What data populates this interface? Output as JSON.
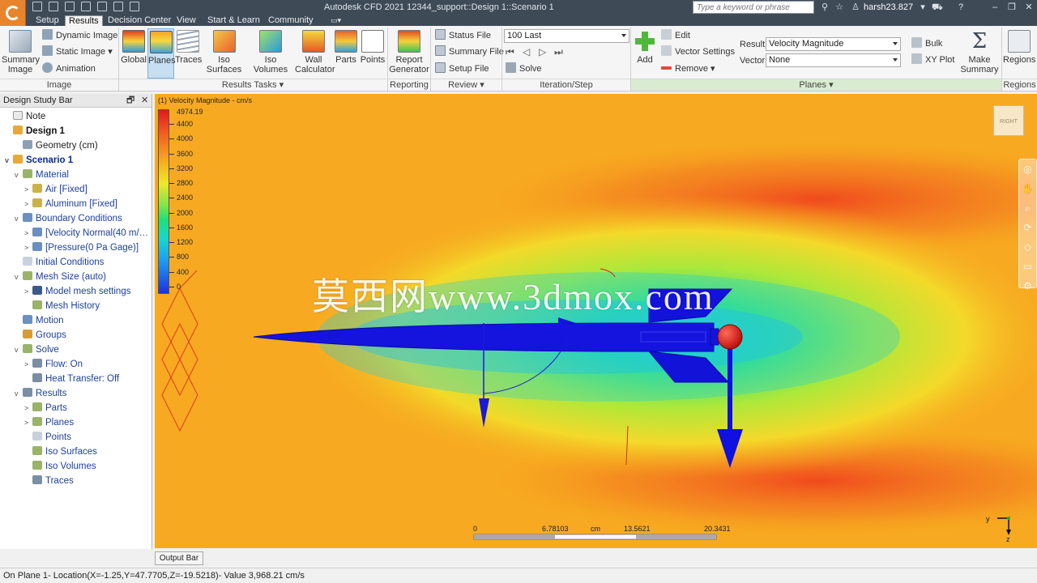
{
  "app": {
    "title": "Autodesk CFD 2021   12344_support::Design 1::Scenario 1",
    "search_placeholder": "Type a keyword or phrase",
    "user": "harsh23.827",
    "brand_color": "#e8842b"
  },
  "menu_tabs": [
    "Setup",
    "Results",
    "Decision Center",
    "View",
    "Start & Learn",
    "Community"
  ],
  "active_tab": "Results",
  "ribbon": {
    "image": {
      "summary_image": "Summary Image",
      "dynamic_image": "Dynamic Image",
      "static_image": "Static Image",
      "animation": "Animation",
      "footer": "Image"
    },
    "results_tasks": {
      "global": "Global",
      "planes": "Planes",
      "traces": "Traces",
      "iso_surfaces": "Iso Surfaces",
      "iso_volumes": "Iso Volumes",
      "wall_calculator": "Wall Calculator",
      "parts": "Parts",
      "points": "Points",
      "footer": "Results Tasks"
    },
    "reporting": {
      "report_generator": "Report Generator",
      "footer": "Reporting"
    },
    "review": {
      "status_file": "Status File",
      "summary_file": "Summary File",
      "setup_file": "Setup File",
      "footer": "Review"
    },
    "iteration": {
      "step_value": "100 Last",
      "solve": "Solve",
      "footer": "Iteration/Step"
    },
    "planes": {
      "add": "Add",
      "edit": "Edit",
      "vector_settings": "Vector Settings",
      "remove": "Remove",
      "result_label": "Result:",
      "result_value": "Velocity Magnitude",
      "vector_label": "Vector:",
      "vector_value": "None",
      "bulk": "Bulk",
      "xy_plot": "XY Plot",
      "make_summary": "Make Summary",
      "footer": "Planes"
    },
    "regions": {
      "label": "Regions",
      "footer": "Regions"
    }
  },
  "design_study_bar": {
    "title": "Design Study Bar",
    "items": [
      {
        "label": "Note",
        "expander": "",
        "icon": "note-icon"
      },
      {
        "label": "Design 1",
        "expander": "",
        "icon": "design-icon"
      },
      {
        "label": "Geometry (cm)",
        "expander": "",
        "icon": "geometry-icon"
      },
      {
        "label": "Scenario 1",
        "expander": "v",
        "icon": "scenario-icon"
      },
      {
        "label": "Material",
        "expander": "v",
        "icon": "material-icon"
      },
      {
        "label": "Air [Fixed]",
        "expander": ">",
        "icon": "material-item-icon"
      },
      {
        "label": "Aluminum [Fixed]",
        "expander": ">",
        "icon": "material-item-icon"
      },
      {
        "label": "Boundary Conditions",
        "expander": "v",
        "icon": "boundary-icon"
      },
      {
        "label": "[Velocity Normal(40 m/…",
        "expander": ">",
        "icon": "boundary-item-icon"
      },
      {
        "label": "[Pressure(0 Pa Gage)]",
        "expander": ">",
        "icon": "boundary-item-icon"
      },
      {
        "label": "Initial Conditions",
        "expander": "",
        "icon": "initial-conditions-icon"
      },
      {
        "label": "Mesh Size (auto)",
        "expander": "v",
        "icon": "mesh-icon"
      },
      {
        "label": "Model mesh settings",
        "expander": ">",
        "icon": "info-icon"
      },
      {
        "label": "Mesh History",
        "expander": "",
        "icon": "mesh-history-icon"
      },
      {
        "label": "Motion",
        "expander": "",
        "icon": "motion-icon"
      },
      {
        "label": "Groups",
        "expander": "",
        "icon": "groups-icon"
      },
      {
        "label": "Solve",
        "expander": "v",
        "icon": "solve-icon"
      },
      {
        "label": "Flow: On",
        "expander": ">",
        "icon": "flow-icon"
      },
      {
        "label": "Heat Transfer: Off",
        "expander": "",
        "icon": "heat-icon"
      },
      {
        "label": "Results",
        "expander": "v",
        "icon": "results-icon"
      },
      {
        "label": "Parts",
        "expander": ">",
        "icon": "parts-icon"
      },
      {
        "label": "Planes",
        "expander": ">",
        "icon": "planes-icon"
      },
      {
        "label": "Points",
        "expander": "",
        "icon": "points-icon"
      },
      {
        "label": "Iso Surfaces",
        "expander": "",
        "icon": "iso-surfaces-icon"
      },
      {
        "label": "Iso Volumes",
        "expander": "",
        "icon": "iso-volumes-icon"
      },
      {
        "label": "Traces",
        "expander": "",
        "icon": "traces-icon"
      }
    ]
  },
  "viewport": {
    "plot_title": "(1) Velocity Magnitude - cm/s",
    "legend_max": "4974.19",
    "legend_labels": [
      "4400",
      "4000",
      "3600",
      "3200",
      "2800",
      "2400",
      "2000",
      "1600",
      "1200",
      "800",
      "400",
      "0"
    ],
    "ruler_labels": [
      "0",
      "6.78103",
      "cm",
      "13.5621",
      "20.3431"
    ],
    "watermark": "莫西网www.3dmox.com",
    "viewcube_label": "RIGHT",
    "triad_labels": [
      "y",
      "z"
    ]
  },
  "output_bar_label": "Output Bar",
  "status_text": "On Plane 1- Location(X=-1.25,Y=47.7705,Z=-19.5218)- Value  3,968.21  cm/s"
}
